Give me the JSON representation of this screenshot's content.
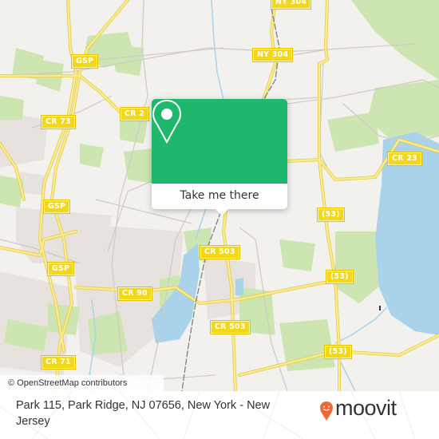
{
  "map": {
    "attribution": "© OpenStreetMap contributors",
    "colors": {
      "land": "#f2f1ee",
      "park": "#cde5b0",
      "residential": "#e8e2df",
      "water": "#a9d3ea",
      "road_major": "#f6e27a",
      "road_minor": "#cfcac5",
      "rail": "#777777",
      "shield": "#f3d719"
    },
    "road_labels": [
      {
        "id": "ny304-top",
        "text": "NY 304"
      },
      {
        "id": "gsp-1",
        "text": "GSP"
      },
      {
        "id": "ny304",
        "text": "NY 304"
      },
      {
        "id": "cr2",
        "text": "CR 2"
      },
      {
        "id": "cr73",
        "text": "CR 73"
      },
      {
        "id": "cr23",
        "text": "CR 23"
      },
      {
        "id": "gsp-2",
        "text": "GSP"
      },
      {
        "id": "53-a",
        "text": "(53)"
      },
      {
        "id": "gsp-3",
        "text": "GSP"
      },
      {
        "id": "cr503-a",
        "text": "CR 503"
      },
      {
        "id": "cr90",
        "text": "CR 90"
      },
      {
        "id": "53-b",
        "text": "(53)"
      },
      {
        "id": "cr503-b",
        "text": "CR 503"
      },
      {
        "id": "53-c",
        "text": "(53)"
      },
      {
        "id": "cr71",
        "text": "CR 71"
      }
    ]
  },
  "popup": {
    "cta_label": "Take me there",
    "accent_color": "#1fb76b",
    "icon": "location-pin-icon"
  },
  "footer": {
    "address": "Park 115, Park Ridge, NJ 07656, New York - New Jersey",
    "logo_text": "moovit",
    "logo_color": "#f06a35"
  }
}
